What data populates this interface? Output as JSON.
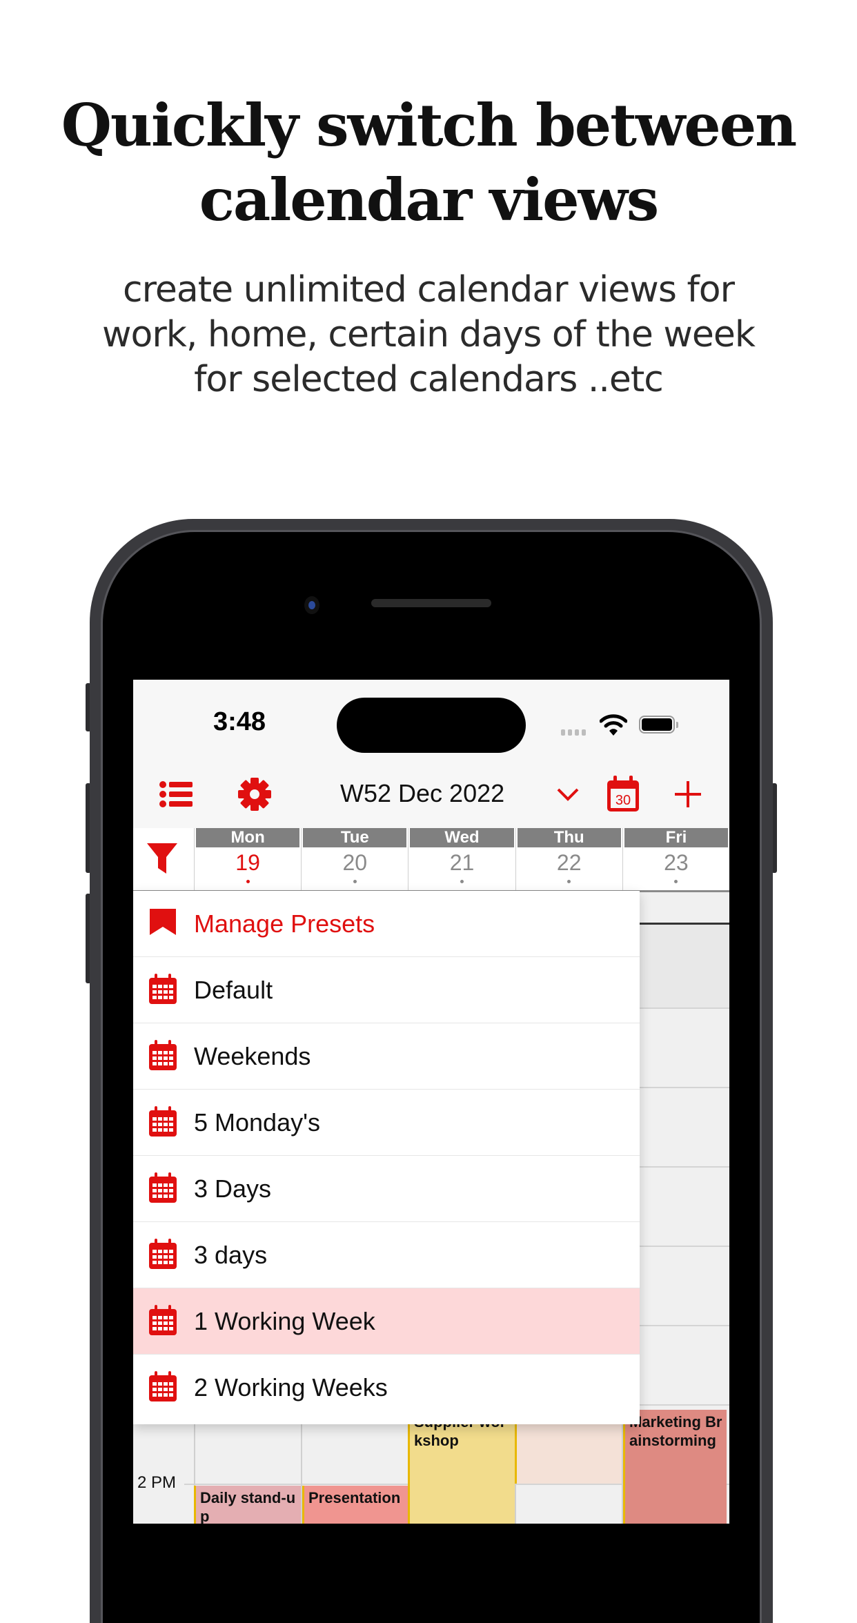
{
  "marketing": {
    "title_line1": "Quickly switch between",
    "title_line2": "calendar views",
    "subtitle_line1": "create unlimited calendar views for",
    "subtitle_line2": "work, home, certain days of the week",
    "subtitle_line3": "for selected calendars ..etc"
  },
  "status_bar": {
    "time": "3:48",
    "icons": [
      "signal-icon",
      "wifi-icon",
      "battery-icon"
    ]
  },
  "toolbar": {
    "title": "W52 Dec 2022",
    "today_icon_day": "30",
    "icons": [
      "list-icon",
      "gear-icon",
      "chevron-down-icon",
      "calendar-today-icon",
      "plus-icon"
    ]
  },
  "colors": {
    "accent": "#e01010",
    "selected_row": "#fdd8d9",
    "day_header": "#808080"
  },
  "days": [
    {
      "name": "Mon",
      "date": "19",
      "today": true
    },
    {
      "name": "Tue",
      "date": "20",
      "today": false
    },
    {
      "name": "Wed",
      "date": "21",
      "today": false
    },
    {
      "name": "Thu",
      "date": "22",
      "today": false
    },
    {
      "name": "Fri",
      "date": "23",
      "today": false
    }
  ],
  "presets_menu": {
    "manage_label": "Manage Presets",
    "items": [
      {
        "label": "Default",
        "selected": false
      },
      {
        "label": "Weekends",
        "selected": false
      },
      {
        "label": "5 Monday's",
        "selected": false
      },
      {
        "label": "3 Days",
        "selected": false
      },
      {
        "label": "3 days",
        "selected": false
      },
      {
        "label": "1 Working Week",
        "selected": true
      },
      {
        "label": "2 Working Weeks",
        "selected": false
      }
    ]
  },
  "grid": {
    "hour_label": "2 PM"
  },
  "events": [
    {
      "title": "Supplier workshop",
      "day": "Wed",
      "color": "#f2dc8c"
    },
    {
      "title": "",
      "day": "Thu",
      "color": "#f4e1d7"
    },
    {
      "title": "Marketing Brainstorming",
      "day": "Fri",
      "color": "#de8a82"
    },
    {
      "title": "Daily stand-up",
      "day": "Mon",
      "color": "#e4aeb2"
    },
    {
      "title": "Presentation",
      "day": "Tue",
      "color": "#f09590"
    }
  ]
}
